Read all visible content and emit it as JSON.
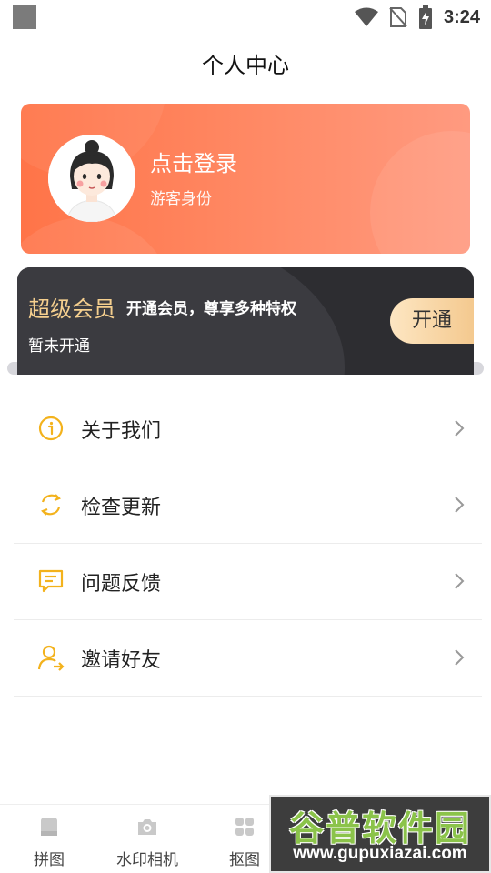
{
  "status_bar": {
    "time": "3:24"
  },
  "page": {
    "title": "个人中心"
  },
  "login_card": {
    "title": "点击登录",
    "subtitle": "游客身份"
  },
  "vip_card": {
    "title": "超级会员",
    "description": "开通会员，尊享多种特权",
    "status": "暂未开通",
    "button_label": "开通"
  },
  "menu": {
    "items": [
      {
        "label": "关于我们",
        "icon": "info-icon"
      },
      {
        "label": "检查更新",
        "icon": "refresh-icon"
      },
      {
        "label": "问题反馈",
        "icon": "feedback-icon"
      },
      {
        "label": "邀请好友",
        "icon": "invite-user-icon"
      }
    ]
  },
  "bottom_nav": {
    "items": [
      {
        "label": "拼图",
        "icon": "collage-icon"
      },
      {
        "label": "水印相机",
        "icon": "camera-icon"
      },
      {
        "label": "抠图",
        "icon": "grid-icon"
      }
    ]
  },
  "watermark": {
    "title": "谷普软件园",
    "url": "www.gupuxiazai.com"
  },
  "colors": {
    "accent": "#f3b21c",
    "login_card": "#ff7b52",
    "vip_card": "#2d2d31",
    "vip_gold": "#f5cf8e"
  }
}
